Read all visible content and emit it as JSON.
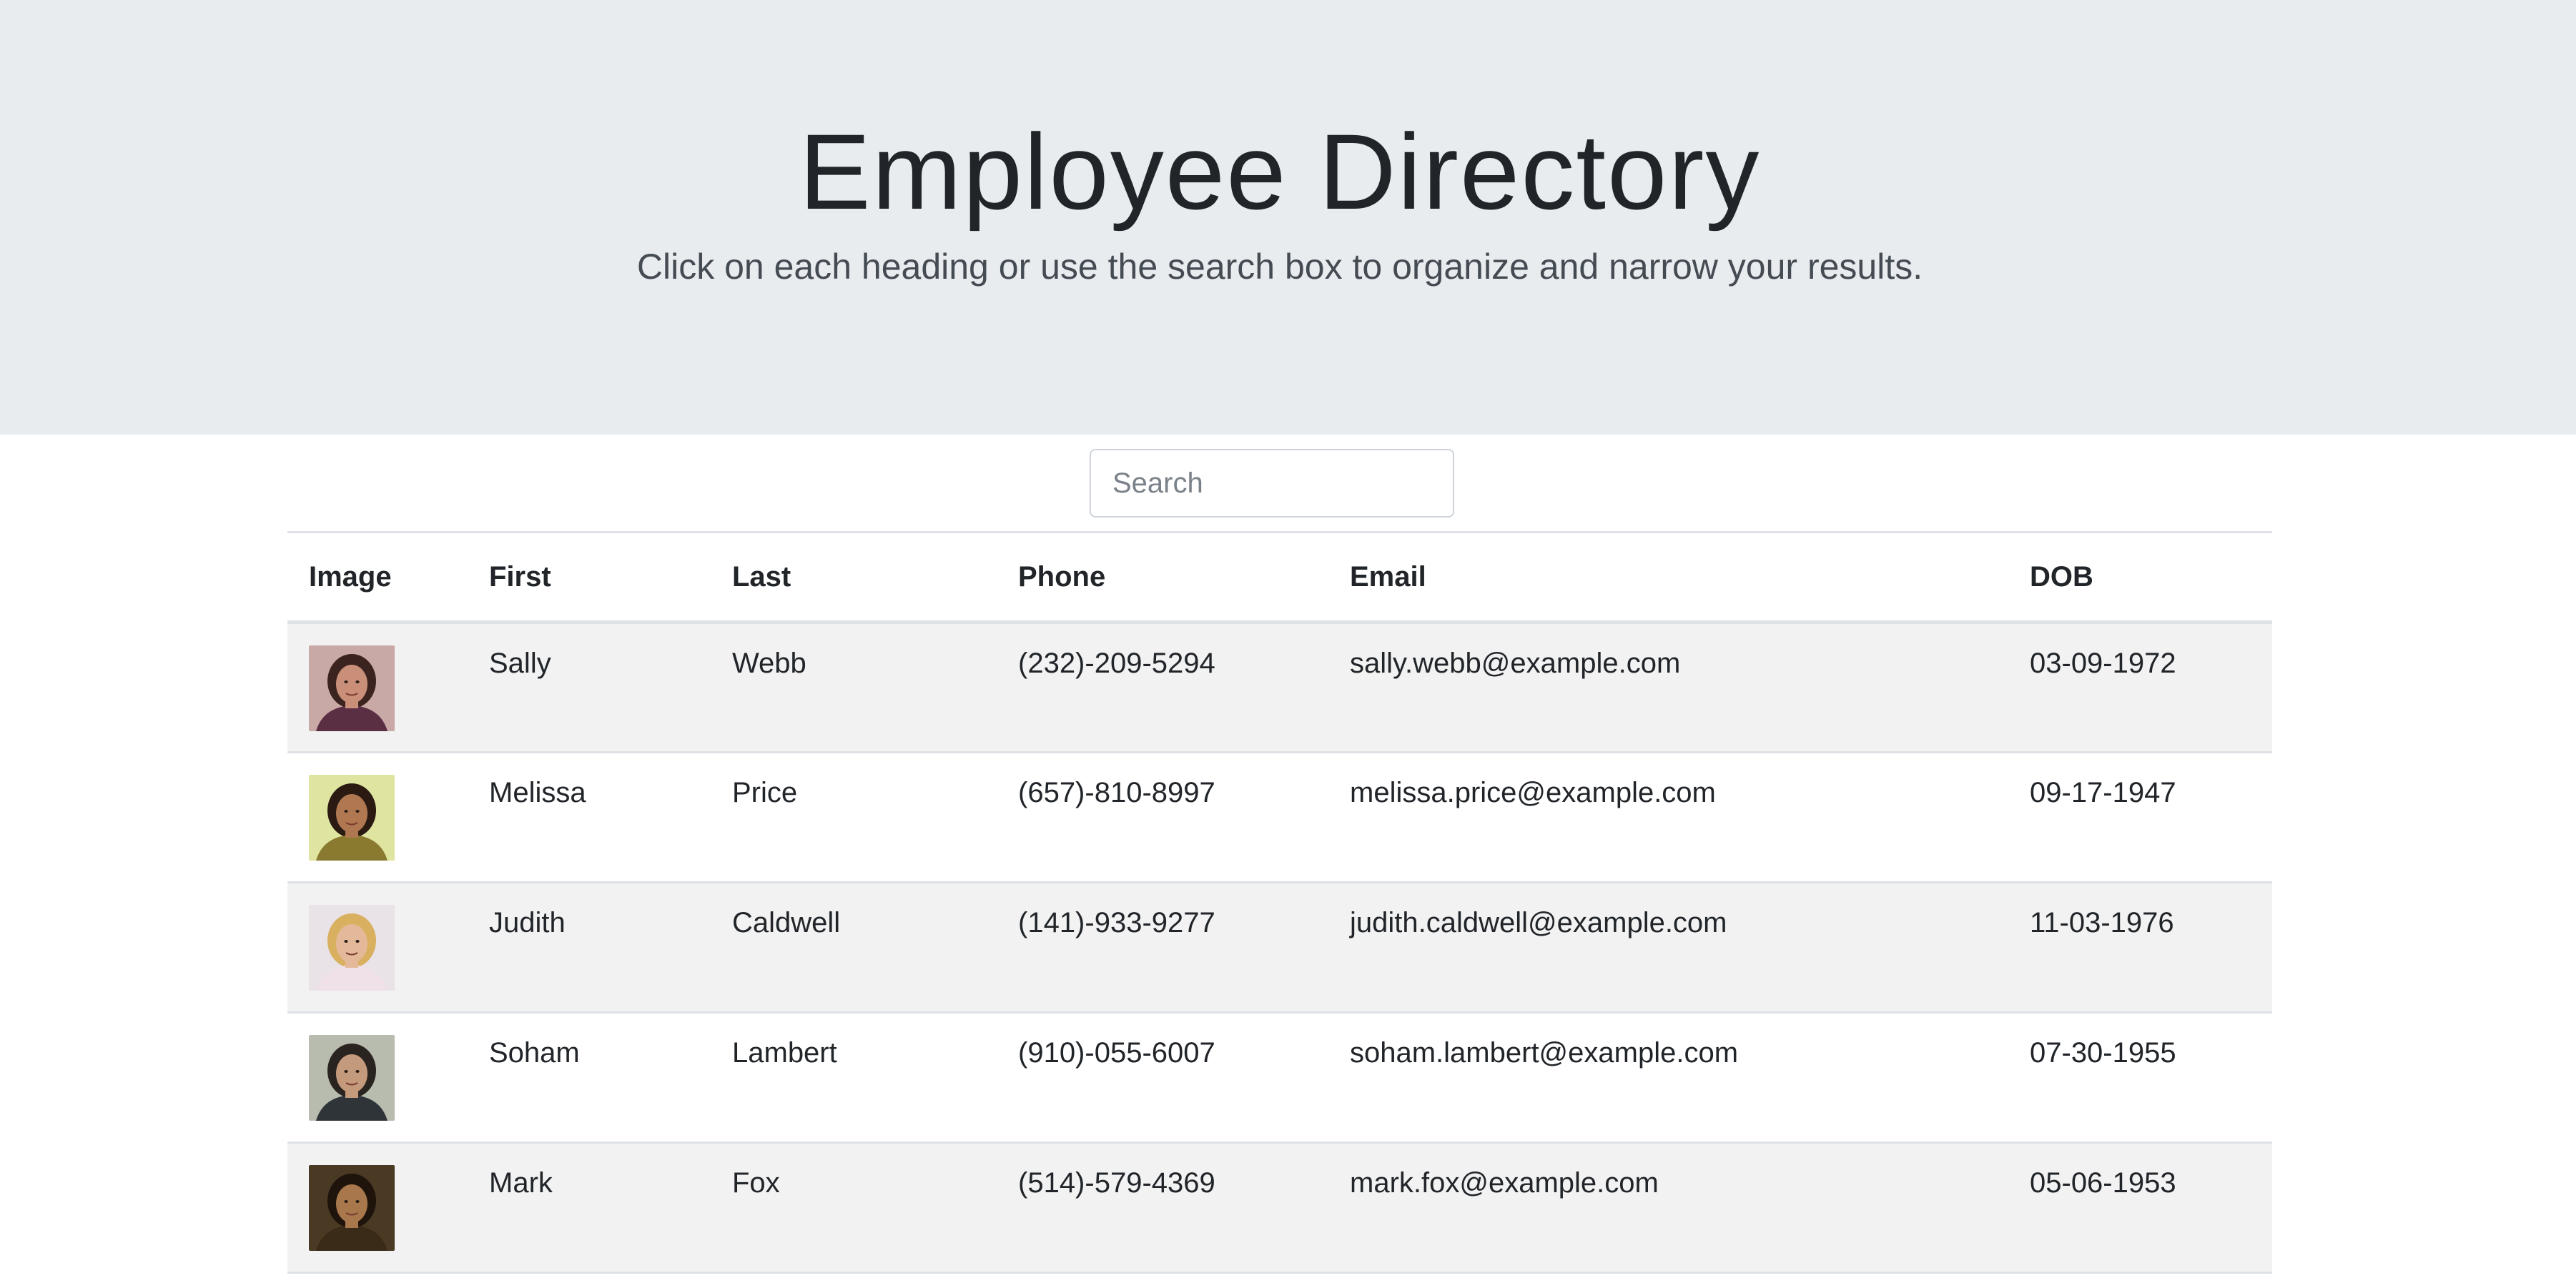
{
  "header": {
    "title": "Employee Directory",
    "subtitle": "Click on each heading or use the search box to organize and narrow your results."
  },
  "search": {
    "placeholder": "Search",
    "value": ""
  },
  "table": {
    "columns": [
      "Image",
      "First",
      "Last",
      "Phone",
      "Email",
      "DOB"
    ],
    "rows": [
      {
        "first": "Sally",
        "last": "Webb",
        "phone": "(232)-209-5294",
        "email": "sally.webb@example.com",
        "dob": "03-09-1972",
        "avatar": {
          "bg": "#c9a9a6",
          "hair": "#3b2420",
          "skin": "#c98f78",
          "shirt": "#5a2f44"
        }
      },
      {
        "first": "Melissa",
        "last": "Price",
        "phone": "(657)-810-8997",
        "email": "melissa.price@example.com",
        "dob": "09-17-1947",
        "avatar": {
          "bg": "#dfe5a0",
          "hair": "#2a1a12",
          "skin": "#b07850",
          "shirt": "#8a7a30"
        }
      },
      {
        "first": "Judith",
        "last": "Caldwell",
        "phone": "(141)-933-9277",
        "email": "judith.caldwell@example.com",
        "dob": "11-03-1976",
        "avatar": {
          "bg": "#e9e2e6",
          "hair": "#d8b060",
          "skin": "#e4b99a",
          "shirt": "#f0e0e8"
        }
      },
      {
        "first": "Soham",
        "last": "Lambert",
        "phone": "(910)-055-6007",
        "email": "soham.lambert@example.com",
        "dob": "07-30-1955",
        "avatar": {
          "bg": "#b8bcae",
          "hair": "#2a2420",
          "skin": "#c49a7c",
          "shirt": "#2e3438"
        }
      },
      {
        "first": "Mark",
        "last": "Fox",
        "phone": "(514)-579-4369",
        "email": "mark.fox@example.com",
        "dob": "05-06-1953",
        "avatar": {
          "bg": "#4a3a24",
          "hair": "#1e140c",
          "skin": "#a8784c",
          "shirt": "#3a2a18"
        }
      }
    ]
  }
}
